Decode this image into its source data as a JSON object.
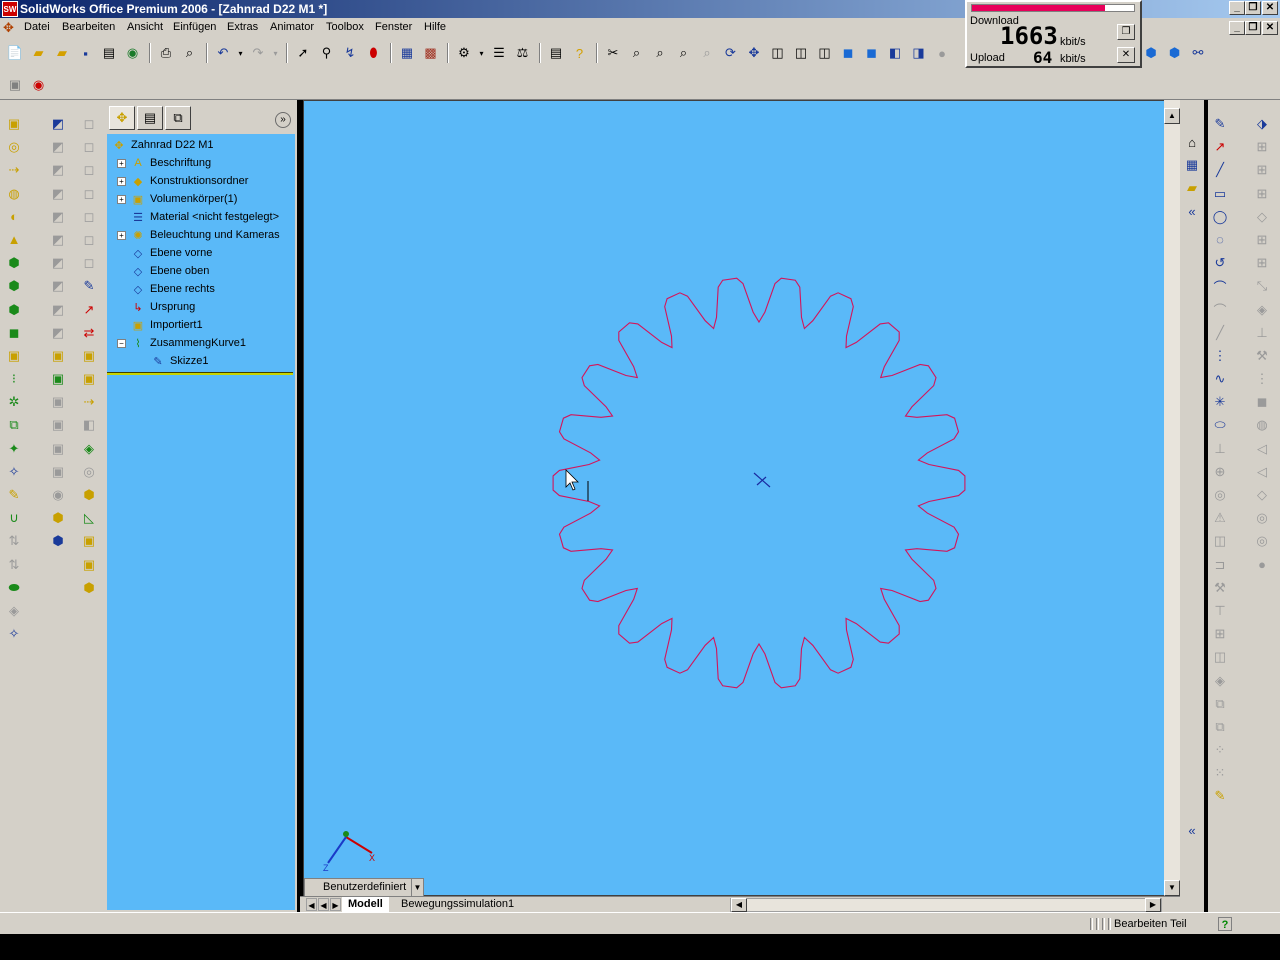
{
  "window": {
    "title": "SolidWorks Office Premium 2006 - [Zahnrad D22 M1 *]",
    "app_badge": "SW",
    "min_glyph": "_",
    "restore_glyph": "❐",
    "close_glyph": "✕"
  },
  "menu": {
    "items": [
      "Datei",
      "Bearbeiten",
      "Ansicht",
      "Einfügen",
      "Extras",
      "Animator",
      "Toolbox",
      "Fenster",
      "Hilfe"
    ]
  },
  "netmeter": {
    "download_label": "Download",
    "download_value": "1663",
    "upload_label": "Upload",
    "upload_value": "64",
    "unit": "kbit/s",
    "download_level": 0.82,
    "bar_color": "#e8005a"
  },
  "feature_tree": {
    "root": "Zahnrad D22 M1",
    "items": [
      {
        "label": "Beschriftung",
        "icon": "annotation-icon",
        "glyph": "A",
        "expandable": true,
        "indent": 0
      },
      {
        "label": "Konstruktionsordner",
        "icon": "design-binder-icon",
        "glyph": "◆",
        "expandable": true,
        "indent": 0
      },
      {
        "label": "Volumenkörper(1)",
        "icon": "solid-bodies-icon",
        "glyph": "▣",
        "expandable": true,
        "indent": 0
      },
      {
        "label": "Material <nicht festgelegt>",
        "icon": "material-icon",
        "glyph": "☰",
        "expandable": false,
        "indent": 0
      },
      {
        "label": "Beleuchtung und Kameras",
        "icon": "lights-icon",
        "glyph": "✺",
        "expandable": true,
        "indent": 0
      },
      {
        "label": "Ebene vorne",
        "icon": "plane-icon",
        "glyph": "◇",
        "expandable": false,
        "indent": 0
      },
      {
        "label": "Ebene oben",
        "icon": "plane-icon",
        "glyph": "◇",
        "expandable": false,
        "indent": 0
      },
      {
        "label": "Ebene rechts",
        "icon": "plane-icon",
        "glyph": "◇",
        "expandable": false,
        "indent": 0
      },
      {
        "label": "Ursprung",
        "icon": "origin-icon",
        "glyph": "↳",
        "expandable": false,
        "indent": 0
      },
      {
        "label": "Importiert1",
        "icon": "imported-icon",
        "glyph": "▣",
        "expandable": false,
        "indent": 0
      },
      {
        "label": "ZusammengKurve1",
        "icon": "composite-curve-icon",
        "glyph": "⌇",
        "expandable": true,
        "expanded": true,
        "indent": 0
      },
      {
        "label": "Skizze1",
        "icon": "sketch-icon",
        "glyph": "✎",
        "expandable": false,
        "indent": 1
      }
    ]
  },
  "viewport": {
    "background": "#5ab9f8",
    "gear_stroke": "#d4145a",
    "gear_teeth": 22,
    "triad": {
      "x": "X",
      "z": "Z"
    }
  },
  "view_selector": {
    "label": "Benutzerdefiniert"
  },
  "tabs": {
    "model": "Modell",
    "motion": "Bewegungssimulation1"
  },
  "status": {
    "mode": "Bearbeiten Teil",
    "help": "?"
  },
  "colors": {
    "chrome": "#d4d0c8",
    "panel_bg": "#5ab9f8",
    "title_start": "#0a246a",
    "title_end": "#a6caf0"
  }
}
